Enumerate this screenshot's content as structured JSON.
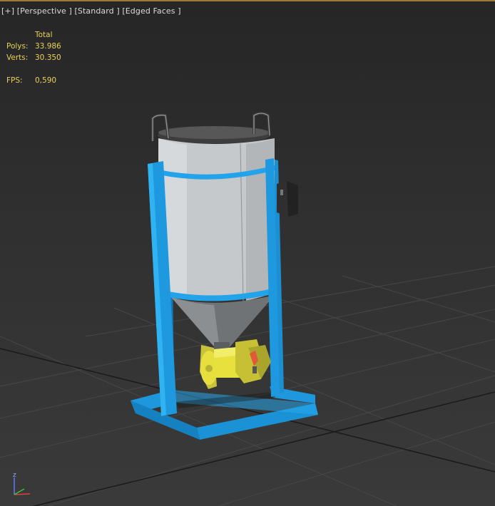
{
  "viewport": {
    "label_plus": "[+]",
    "label_view": "[Perspective ]",
    "label_shading": "[Standard ]",
    "label_edges": "[Edged Faces ]"
  },
  "stats": {
    "header": "Total",
    "polys_label": "Polys:",
    "polys_value": "33.986",
    "verts_label": "Verts:",
    "verts_value": "30.350",
    "fps_label": "FPS:",
    "fps_value": "0,590"
  },
  "axis_gizmo": {
    "z_label": "z"
  },
  "colors": {
    "active_border": "#a0793a",
    "stats_text": "#e8d25a",
    "frame": "#1f9de2",
    "motor": "#e6e04a",
    "tank": "#c7cacc",
    "grid": "#4a4a4a"
  }
}
